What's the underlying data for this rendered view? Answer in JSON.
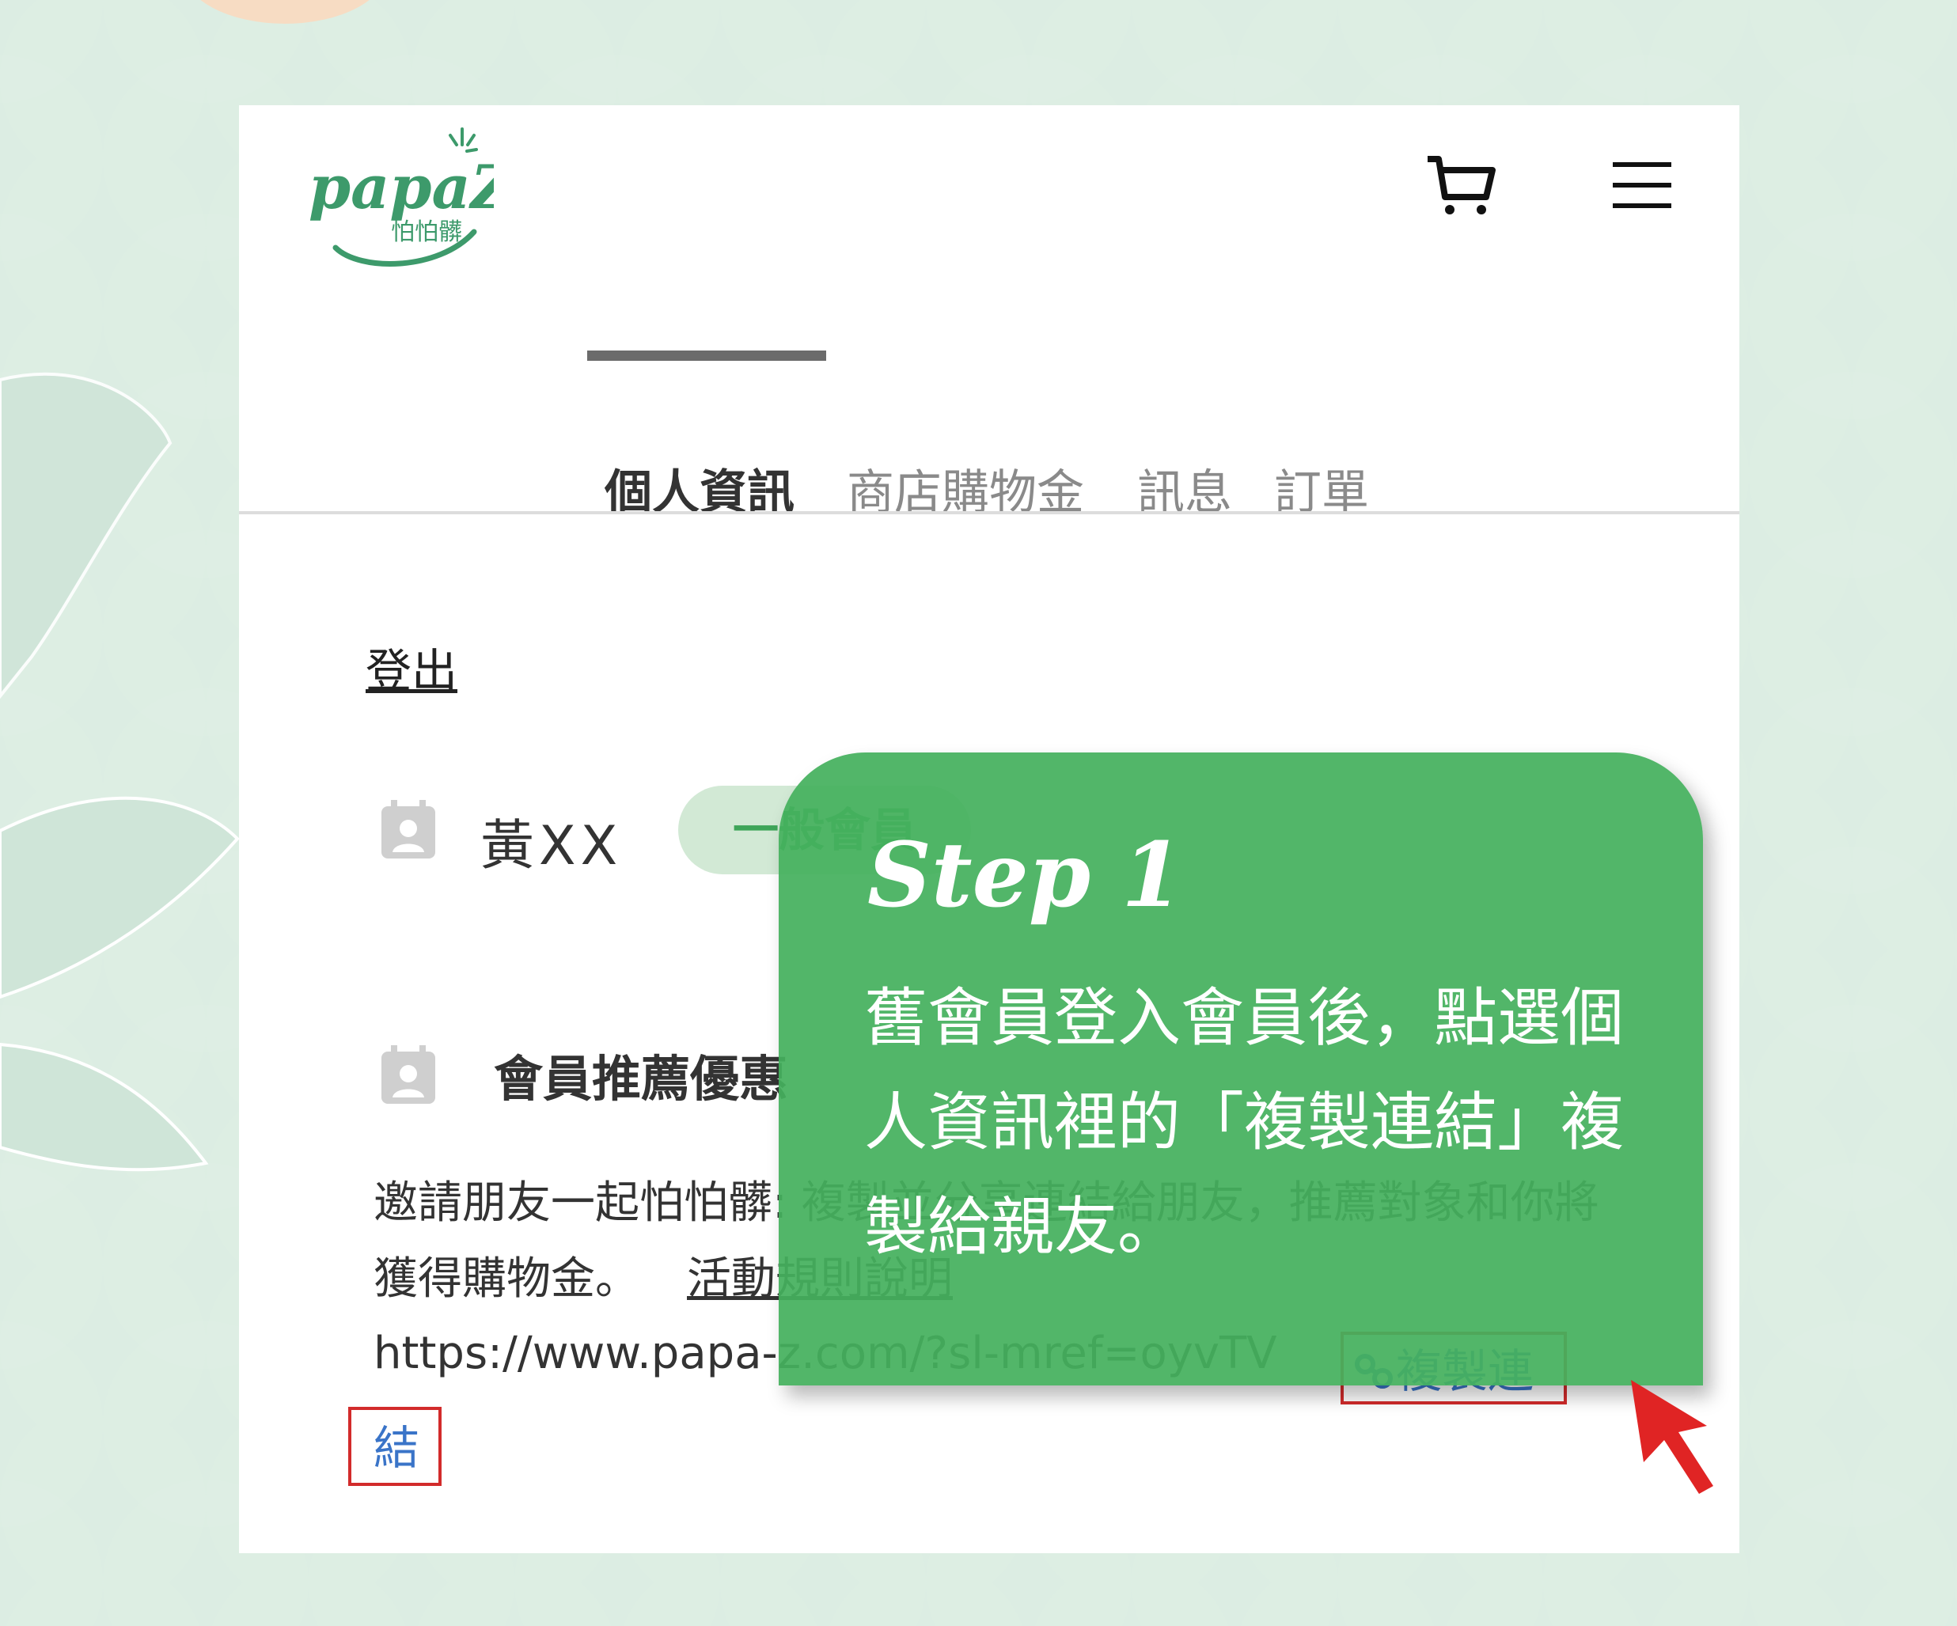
{
  "brand": {
    "logo_text": "papaZ",
    "logo_subtext": "怕怕髒"
  },
  "header": {
    "cart_icon": "cart-icon",
    "menu_icon": "hamburger-menu-icon"
  },
  "tabs": [
    {
      "label": "個人資訊",
      "active": true
    },
    {
      "label": "商店購物金",
      "active": false
    },
    {
      "label": "訊息",
      "active": false
    },
    {
      "label": "訂單",
      "active": false
    }
  ],
  "account": {
    "logout_label": "登出",
    "user_name": "黃XX",
    "member_level": "一般會員",
    "referral_title": "會員推薦優惠",
    "invite_text": "邀請朋友一起怕怕髒: 複製並分享連結給朋友，推薦對象和你將獲得購物金。",
    "rules_link": "活動規則說明",
    "referral_url": "https://www.papa-z.com/?sl-mref=oyvTV",
    "copy_link_part1": "複製連",
    "copy_link_part2": "結"
  },
  "callout": {
    "step_title": "Step 1",
    "step_description": "舊會員登入會員後，點選個人資訊裡的「複製連結」複製給親友。"
  },
  "colors": {
    "background": "#d7ebe0",
    "brand_green": "#3d9a6b",
    "callout_green": "#45b05e",
    "link_blue": "#3a74c8",
    "highlight_red": "#d22b2b"
  }
}
